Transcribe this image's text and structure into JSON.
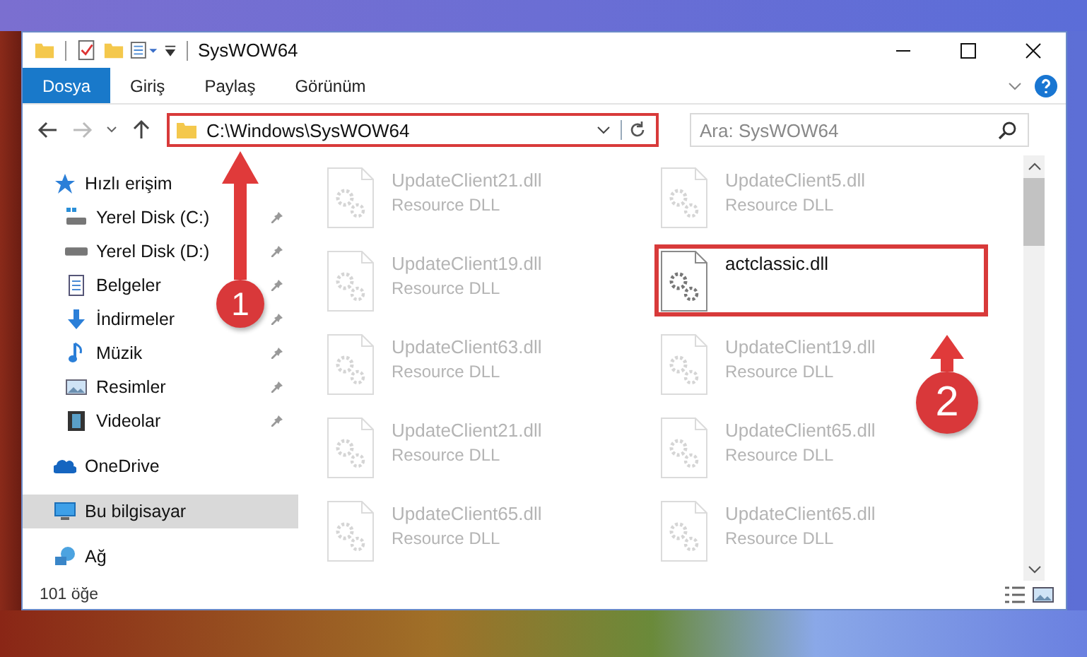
{
  "window": {
    "title": "SysWOW64"
  },
  "ribbon": {
    "tabs": [
      {
        "label": "Dosya",
        "selected": true
      },
      {
        "label": "Giriş",
        "selected": false
      },
      {
        "label": "Paylaş",
        "selected": false
      },
      {
        "label": "Görünüm",
        "selected": false
      }
    ]
  },
  "address": {
    "path": "C:\\Windows\\SysWOW64",
    "highlighted": true
  },
  "search": {
    "placeholder": "Ara: SysWOW64"
  },
  "sidebar": {
    "items": [
      {
        "kind": "star",
        "label": "Hızlı erişim",
        "selected": false,
        "children": [
          {
            "kind": "disk-windows",
            "label": "Yerel Disk (C:)",
            "pinned": true,
            "selected": false
          },
          {
            "kind": "disk",
            "label": "Yerel Disk (D:)",
            "pinned": true,
            "selected": false
          },
          {
            "kind": "document",
            "label": "Belgeler",
            "pinned": true,
            "selected": false
          },
          {
            "kind": "download",
            "label": "İndirmeler",
            "pinned": true,
            "selected": false
          },
          {
            "kind": "music",
            "label": "Müzik",
            "pinned": true,
            "selected": false
          },
          {
            "kind": "pictures",
            "label": "Resimler",
            "pinned": true,
            "selected": false
          },
          {
            "kind": "video",
            "label": "Videolar",
            "pinned": true,
            "selected": false
          }
        ]
      },
      {
        "kind": "cloud",
        "label": "OneDrive",
        "selected": false
      },
      {
        "kind": "computer",
        "label": "Bu bilgisayar",
        "selected": true
      },
      {
        "kind": "network",
        "label": "Ağ",
        "selected": false
      }
    ]
  },
  "files": [
    {
      "name": "UpdateClient21.dll",
      "type": "Resource DLL",
      "faded": true,
      "highlighted": false
    },
    {
      "name": "UpdateClient5.dll",
      "type": "Resource DLL",
      "faded": true,
      "highlighted": false
    },
    {
      "name": "UpdateClient19.dll",
      "type": "Resource DLL",
      "faded": true,
      "highlighted": false
    },
    {
      "name": "actclassic.dll",
      "faded": false,
      "highlighted": true
    },
    {
      "name": "UpdateClient63.dll",
      "type": "Resource DLL",
      "faded": true,
      "highlighted": false
    },
    {
      "name": "UpdateClient19.dll",
      "type": "Resource DLL",
      "faded": true,
      "highlighted": false
    },
    {
      "name": "UpdateClient21.dll",
      "type": "Resource DLL",
      "faded": true,
      "highlighted": false
    },
    {
      "name": "UpdateClient65.dll",
      "type": "Resource DLL",
      "faded": true,
      "highlighted": false
    },
    {
      "name": "UpdateClient65.dll",
      "type": "Resource DLL",
      "faded": true,
      "highlighted": false
    },
    {
      "name": "UpdateClient65.dll",
      "type": "Resource DLL",
      "faded": true,
      "highlighted": false
    }
  ],
  "annotations": [
    {
      "label": "1"
    },
    {
      "label": "2"
    }
  ],
  "status_bar": {
    "count": "101 öğe"
  }
}
